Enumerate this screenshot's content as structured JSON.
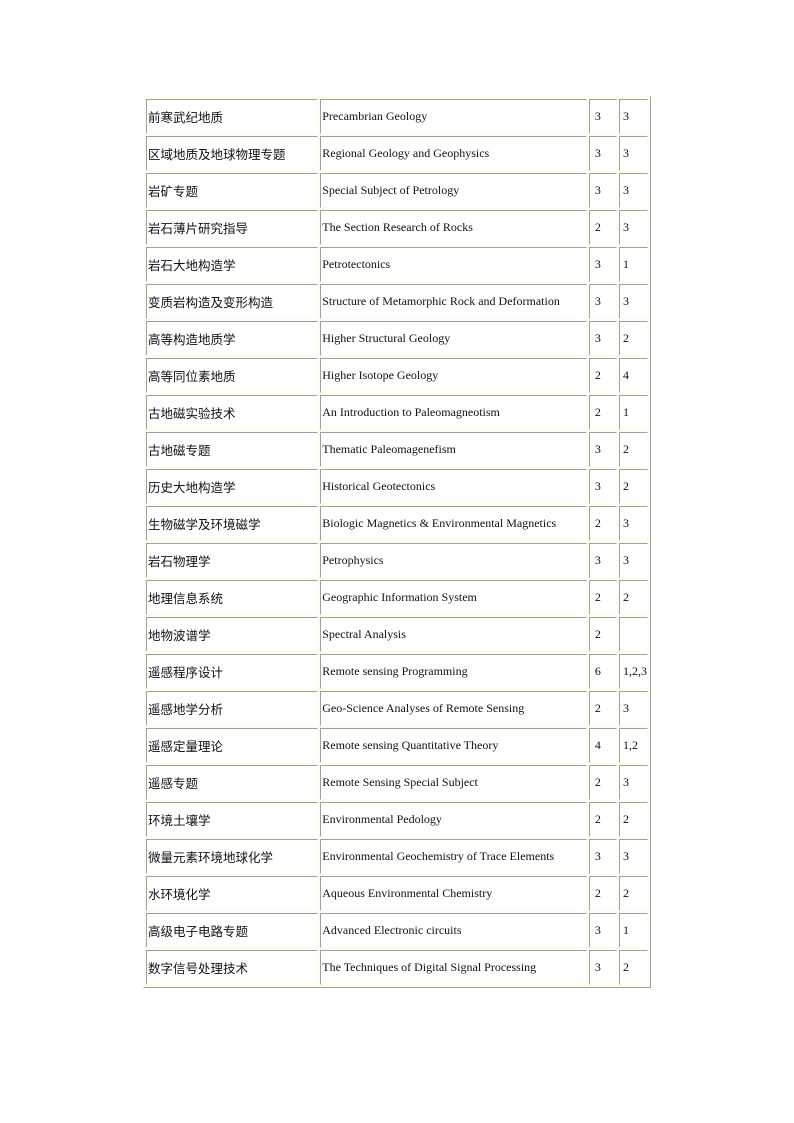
{
  "courses": [
    {
      "zh": "前寒武纪地质",
      "en": "Precambrian  Geology",
      "credits": "3",
      "semester": "3"
    },
    {
      "zh": "区域地质及地球物理专题",
      "en": "Regional Geology and Geophysics",
      "credits": "3",
      "semester": "3"
    },
    {
      "zh": "岩矿专题",
      "en": "Special Subject of Petrology",
      "credits": "3",
      "semester": "3"
    },
    {
      "zh": "岩石薄片研究指导",
      "en": "The Section Research of Rocks",
      "credits": "2",
      "semester": "3"
    },
    {
      "zh": "岩石大地构造学",
      "en": "Petrotectonics",
      "credits": "3",
      "semester": "1"
    },
    {
      "zh": "变质岩构造及变形构造",
      "en": "Structure of Metamorphic  Rock and Deformation",
      "credits": "3",
      "semester": "3"
    },
    {
      "zh": "高等构造地质学",
      "en": "Higher Structural  Geology",
      "credits": "3",
      "semester": "2"
    },
    {
      "zh": "高等同位素地质",
      "en": "Higher Isotope Geology",
      "credits": "2",
      "semester": "4"
    },
    {
      "zh": "古地磁实验技术",
      "en": "An Introduction to Paleomagneotism",
      "credits": "2",
      "semester": "1"
    },
    {
      "zh": "古地磁专题",
      "en": "Thematic  Paleomagenefism",
      "credits": "3",
      "semester": "2"
    },
    {
      "zh": "历史大地构造学",
      "en": "Historical Geotectonics",
      "credits": "3",
      "semester": "2"
    },
    {
      "zh": "生物磁学及环境磁学",
      "en": "Biologic Magnetics & Environmental  Magnetics",
      "credits": "2",
      "semester": "3"
    },
    {
      "zh": "岩石物理学",
      "en": "Petrophysics",
      "credits": "3",
      "semester": "3"
    },
    {
      "zh": "地理信息系统",
      "en": "Geographic Information System",
      "credits": "2",
      "semester": "2"
    },
    {
      "zh": "地物波谱学",
      "en": "Spectral Analysis",
      "credits": "2",
      "semester": ""
    },
    {
      "zh": "遥感程序设计",
      "en": "Remote sensing Programming",
      "credits": "6",
      "semester": "1,2,3"
    },
    {
      "zh": "遥感地学分析",
      "en": "Geo-Science Analyses of Remote  Sensing",
      "credits": "2",
      "semester": "3"
    },
    {
      "zh": "遥感定量理论",
      "en": "Remote sensing Quantitative  Theory",
      "credits": "4",
      "semester": "1,2"
    },
    {
      "zh": "遥感专题",
      "en": "Remote Sensing Special Subject",
      "credits": "2",
      "semester": "3"
    },
    {
      "zh": "环境土壤学",
      "en": "Environmental  Pedology",
      "credits": "2",
      "semester": "2"
    },
    {
      "zh": "微量元素环境地球化学",
      "en": "Environmental  Geochemistry of Trace Elements",
      "credits": "3",
      "semester": "3"
    },
    {
      "zh": "水环境化学",
      "en": "Aqueous Environmental  Chemistry",
      "credits": "2",
      "semester": "2"
    },
    {
      "zh": "高级电子电路专题",
      "en": "Advanced Electronic  circuits",
      "credits": "3",
      "semester": "1"
    },
    {
      "zh": "数字信号处理技术",
      "en": "The Techniques of Digital Signal Processing",
      "credits": "3",
      "semester": "2"
    }
  ]
}
